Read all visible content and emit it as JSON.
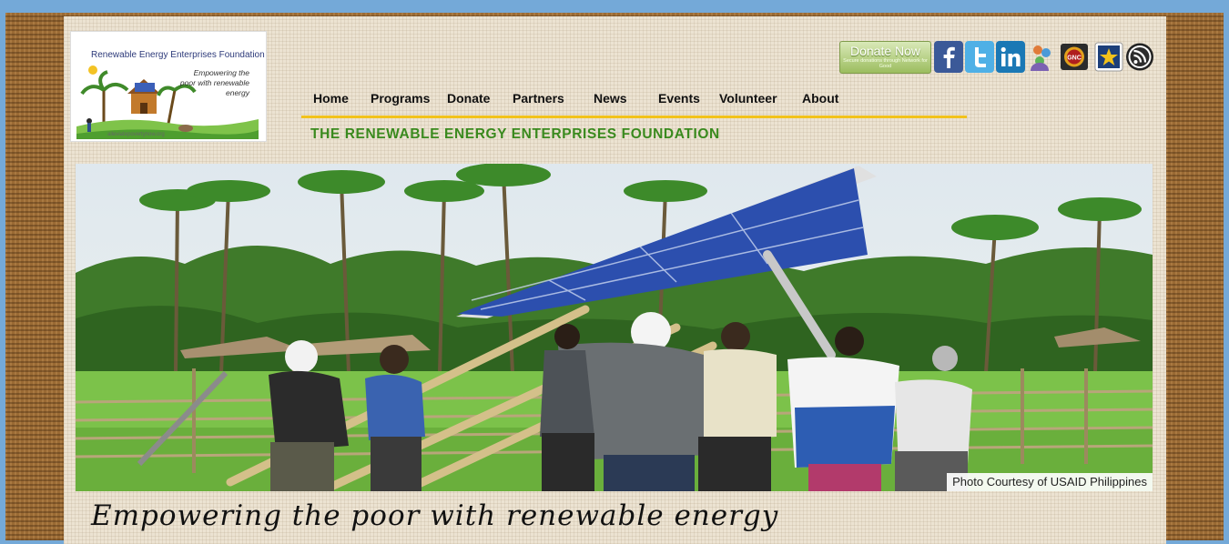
{
  "logo": {
    "title": "Renewable Energy Enterprises Foundation",
    "tagline": "Empowering the poor with renewable energy",
    "url": "alleviatepovertynow.org"
  },
  "nav": {
    "items": [
      {
        "label": "Home"
      },
      {
        "label": "Programs"
      },
      {
        "label": "Donate"
      },
      {
        "label": "Partners"
      },
      {
        "label": "News"
      },
      {
        "label": "Events"
      },
      {
        "label": "Volunteer"
      },
      {
        "label": "About"
      }
    ]
  },
  "header": {
    "org_name": "THE RENEWABLE ENERGY ENTERPRISES FOUNDATION"
  },
  "donate": {
    "label": "Donate Now",
    "sub": "Secure donations through Network for Good"
  },
  "social": {
    "icons": [
      "facebook-icon",
      "twitter-icon",
      "linkedin-icon",
      "people-icon",
      "gnc-icon",
      "star-icon",
      "rss-icon"
    ],
    "gnc_label": "GNC"
  },
  "hero": {
    "credit": "Photo Courtesy of USAID Philippines"
  },
  "tagline": "Empowering the poor with renewable energy",
  "colors": {
    "nav_underline": "#f2c21b",
    "org_name": "#3a8a1e",
    "facebook": "#3b5998",
    "twitter": "#4fb0e6",
    "linkedin": "#1a78b5"
  }
}
